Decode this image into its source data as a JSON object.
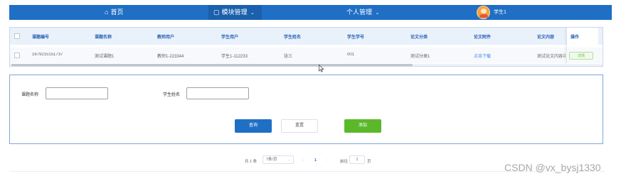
{
  "nav": {
    "home": {
      "icon": "home-icon",
      "label": "首页"
    },
    "modules": {
      "icon": "module-icon",
      "label": "模块管理",
      "caret": "⌄"
    },
    "profile": {
      "label": "个人管理",
      "caret": "⌄"
    },
    "user": {
      "avatar": "avatar",
      "name": "学生1"
    }
  },
  "colors": {
    "nav_bg": "#1f6fc5",
    "header_text": "#2962b6",
    "add_btn": "#5bb82b",
    "link": "#3a86e8"
  },
  "table": {
    "headers": [
      "课题编号",
      "课题名称",
      "教师用户",
      "学生用户",
      "学生姓名",
      "学生学号",
      "论文分类",
      "论文附件",
      "论文内容",
      "操作"
    ],
    "rows": [
      {
        "code": "1679215151737",
        "title": "测试课题1",
        "teacher": "教师1-223344",
        "student_user": "学生1-112233",
        "student_name": "张三",
        "student_no": "001",
        "category": "测试分类1",
        "attachment": "点击下载",
        "content": "测试论文内容详",
        "action": "详情"
      }
    ]
  },
  "search": {
    "topic_label": "课题名称",
    "topic_value": "",
    "student_label": "学生姓名",
    "student_value": "",
    "query_button": "查询",
    "reset_button": "重置",
    "add_button": "添加"
  },
  "pager": {
    "total": "共 1 条",
    "page_size": "7条/页",
    "page_size_arrow": "⌄",
    "prev": "‹",
    "current": "1",
    "next": "›",
    "goto": "前往",
    "jump_value": "1",
    "page_unit": "页"
  },
  "watermark": "CSDN @vx_bysj1330"
}
